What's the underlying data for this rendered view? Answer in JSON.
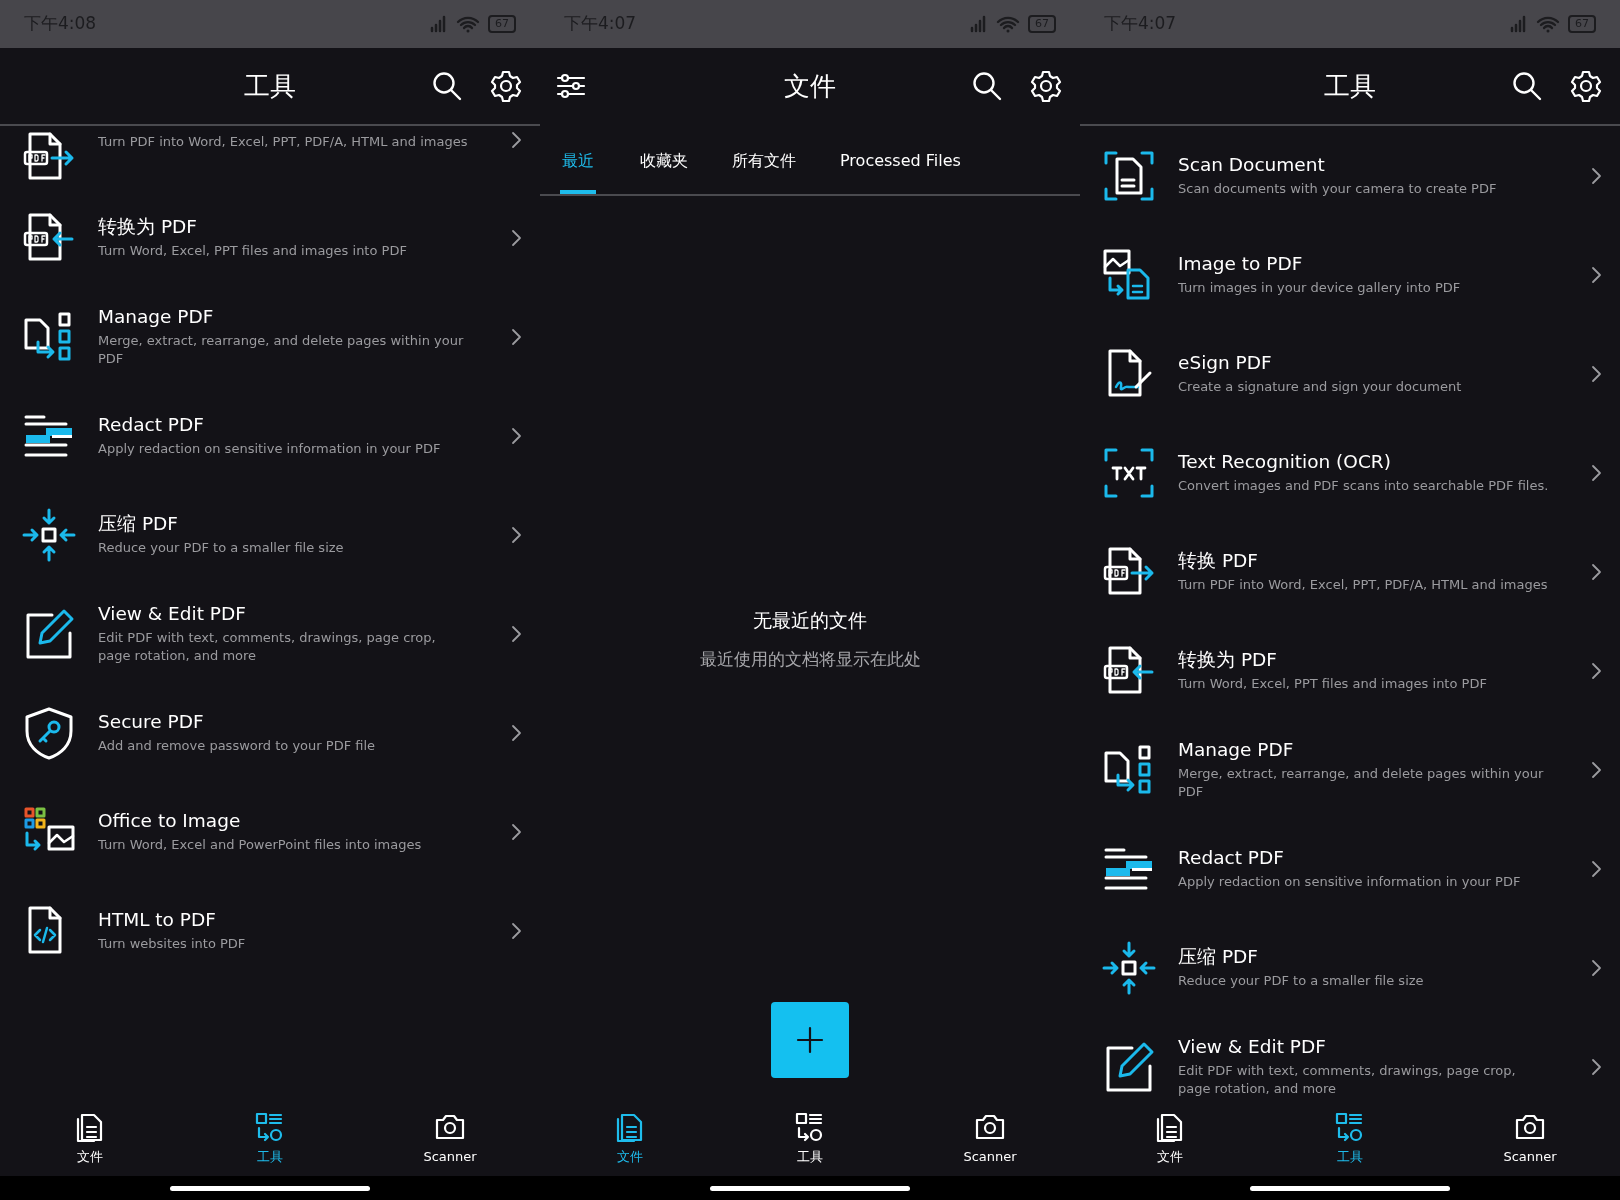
{
  "panels": [
    {
      "kind": "tools",
      "status_bar": {
        "time": "下午4:08",
        "battery": "67"
      },
      "title": "工具",
      "items": [
        {
          "kind": "convert-from",
          "description": "Turn PDF into Word, Excel, PPT, PDF/A, HTML and images"
        },
        {
          "kind": "convert-to",
          "title": "转换为 PDF",
          "description": "Turn Word, Excel, PPT files and images into PDF"
        },
        {
          "kind": "manage",
          "title": "Manage PDF",
          "description": "Merge, extract, rearrange, and delete pages within your PDF"
        },
        {
          "kind": "redact",
          "title": "Redact PDF",
          "description": "Apply redaction on sensitive information in your PDF"
        },
        {
          "kind": "compress",
          "title": "压缩 PDF",
          "description": "Reduce your PDF to a smaller file size"
        },
        {
          "kind": "edit",
          "title": "View & Edit PDF",
          "description": "Edit PDF with text, comments, drawings, page crop, page rotation, and more"
        },
        {
          "kind": "secure",
          "title": "Secure PDF",
          "description": "Add and remove password to your PDF file"
        },
        {
          "kind": "office",
          "title": "Office to Image",
          "description": "Turn Word, Excel and PowerPoint files into images"
        },
        {
          "kind": "html",
          "title": "HTML to PDF",
          "description": "Turn websites into PDF"
        }
      ],
      "nav": [
        {
          "kind": "files",
          "label": "文件",
          "selected": false
        },
        {
          "kind": "tools",
          "label": "工具",
          "selected": true
        },
        {
          "kind": "camera",
          "label": "Scanner",
          "selected": false
        }
      ]
    },
    {
      "kind": "files",
      "status_bar": {
        "time": "下午4:07",
        "battery": "67"
      },
      "title": "文件",
      "tabs": [
        {
          "label": "最近",
          "selected": true
        },
        {
          "label": "收藏夹",
          "selected": false
        },
        {
          "label": "所有文件",
          "selected": false
        },
        {
          "label": "Processed Files",
          "selected": false
        }
      ],
      "empty_state": {
        "title": "无最近的文件",
        "message": "最近使用的文档将显示在此处"
      },
      "nav": [
        {
          "kind": "files",
          "label": "文件",
          "selected": true
        },
        {
          "kind": "tools",
          "label": "工具",
          "selected": false
        },
        {
          "kind": "camera",
          "label": "Scanner",
          "selected": false
        }
      ]
    },
    {
      "kind": "tools",
      "status_bar": {
        "time": "下午4:07",
        "battery": "67"
      },
      "title": "工具",
      "items": [
        {
          "kind": "scan",
          "title": "Scan Document",
          "description": "Scan documents with your camera to create PDF"
        },
        {
          "kind": "image",
          "title": "Image to PDF",
          "description": "Turn images in your device gallery into PDF"
        },
        {
          "kind": "esign",
          "title": "eSign PDF",
          "description": "Create a signature and sign your document"
        },
        {
          "kind": "ocr",
          "title": "Text Recognition (OCR)",
          "description": "Convert images and PDF scans into searchable PDF files."
        },
        {
          "kind": "convert-from",
          "title": "转换 PDF",
          "description": "Turn PDF into Word, Excel, PPT, PDF/A, HTML and images"
        },
        {
          "kind": "convert-to",
          "title": "转换为 PDF",
          "description": "Turn Word, Excel, PPT files and images into PDF"
        },
        {
          "kind": "manage",
          "title": "Manage PDF",
          "description": "Merge, extract, rearrange, and delete pages within your PDF"
        },
        {
          "kind": "redact",
          "title": "Redact PDF",
          "description": "Apply redaction on sensitive information in your PDF"
        },
        {
          "kind": "compress",
          "title": "压缩 PDF",
          "description": "Reduce your PDF to a smaller file size"
        },
        {
          "kind": "edit",
          "title": "View & Edit PDF",
          "description": "Edit PDF with text, comments, drawings, page crop, page rotation, and more"
        }
      ],
      "nav": [
        {
          "kind": "files",
          "label": "文件",
          "selected": false
        },
        {
          "kind": "tools",
          "label": "工具",
          "selected": true
        },
        {
          "kind": "camera",
          "label": "Scanner",
          "selected": false
        }
      ]
    }
  ]
}
